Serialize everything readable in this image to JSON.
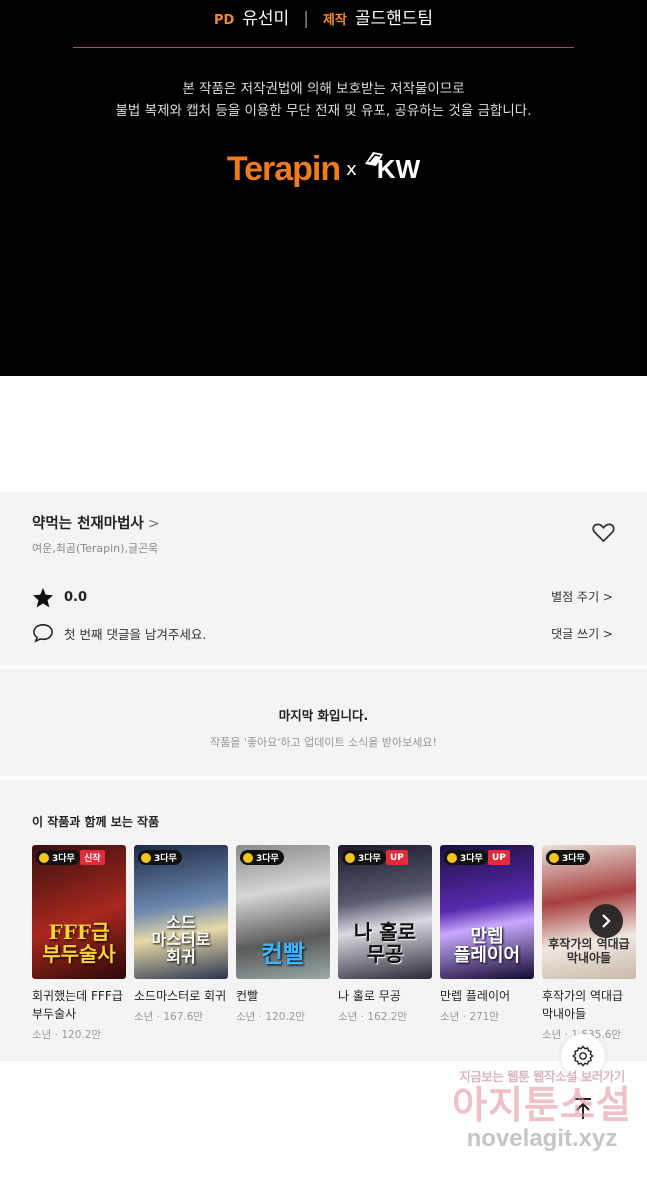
{
  "credits": {
    "pd_role": "PD",
    "pd_name": "유선미",
    "production_role": "제작",
    "production_name": "골드핸드팀",
    "copyright_line1": "본 작품은 저작권법에 의해 보호받는 저작물이므로",
    "copyright_line2": "불법 복제와 캡처 등을 이용한 무단 전재 및 유포, 공유하는 것을 금합니다.",
    "logo_terapin": "Terapin",
    "logo_x": "x",
    "logo_kw": "KW",
    "accent_color": "#f07b1e"
  },
  "info": {
    "title": "약먹는 천재마법사",
    "title_chevron": ">",
    "authors": "여운,최곰(Terapin),글곤욱",
    "rating_value": "0.0",
    "rate_button": "별점 주기 >",
    "comment_prompt": "첫 번째 댓글을 남겨주세요.",
    "comment_button": "댓글 쓰기 >"
  },
  "last_episode": {
    "title": "마지막 화입니다.",
    "subtitle": "작품을 '좋아요'하고 업데이트 소식을 받아보세요!"
  },
  "recommendations": {
    "heading": "이 작품과 함께 보는 작품",
    "items": [
      {
        "badge": "3다무",
        "tag": "신작",
        "cover_text": "FFF급\n부두술사",
        "title": "회귀했는데 FFF급 부두술사",
        "meta": "소년 · 120.2만"
      },
      {
        "badge": "3다무",
        "tag": "",
        "cover_text": "소드\n마스터로\n회귀",
        "title": "소드마스터로 회귀",
        "meta": "소년 · 167.6만"
      },
      {
        "badge": "3다무",
        "tag": "",
        "cover_text": "컨빨",
        "title": "컨빨",
        "meta": "소년 · 120.2만"
      },
      {
        "badge": "3다무",
        "tag": "UP",
        "cover_text": "나 홀로\n무공",
        "title": "나 홀로 무공",
        "meta": "소년 · 162.2만"
      },
      {
        "badge": "3다무",
        "tag": "UP",
        "cover_text": "만렙\n플레이어",
        "title": "만렙 플레이어",
        "meta": "소년 · 271만"
      },
      {
        "badge": "3다무",
        "tag": "",
        "cover_text": "후작가의 역대급\n막내아들",
        "title": "후작가의 역대급 막내아들",
        "meta": "소년 · 1,535.6만"
      }
    ]
  },
  "watermark": {
    "line1": "지금보는 웹툰 웹작소설 보러가기",
    "line2": "아지툰소설",
    "line3": "novelagit.xyz"
  }
}
